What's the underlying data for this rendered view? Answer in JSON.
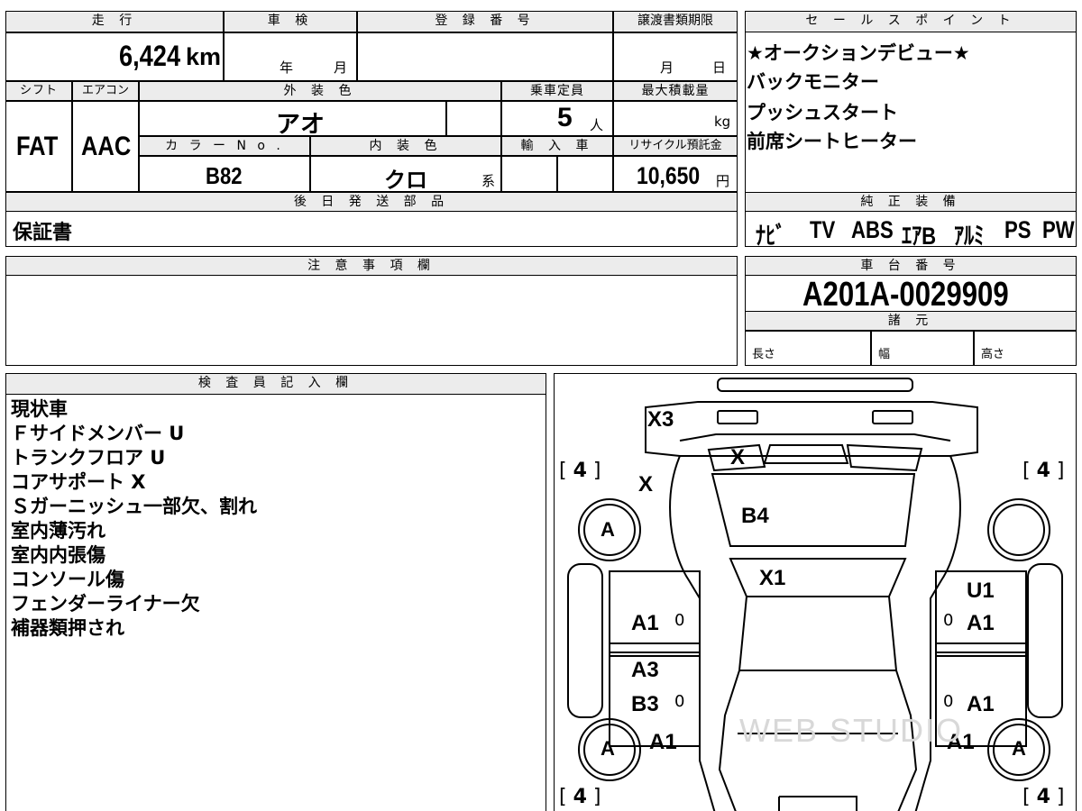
{
  "header": {
    "mileage_label": "走 行",
    "inspection_label": "車 検",
    "registration_label": "登 録 番 号",
    "transfer_deadline_label": "譲渡書類期限",
    "mileage_value": "6,424",
    "mileage_unit": "km",
    "year_unit": "年",
    "month_unit": "月",
    "transfer_month": "月",
    "transfer_day": "日"
  },
  "specs": {
    "shift_label": "シフト",
    "aircon_label": "エアコン",
    "exterior_color_label": "外 装 色",
    "capacity_label": "乗車定員",
    "max_load_label": "最大積載量",
    "shift_value": "FAT",
    "aircon_value": "AAC",
    "exterior_color_value": "アオ",
    "capacity_value": "5",
    "capacity_unit": "人",
    "load_unit": "kg",
    "color_no_label": "カ ラ ー N o .",
    "interior_color_label": "内 装 色",
    "import_label": "輸 入 車",
    "recycle_label": "リサイクル預託金",
    "color_no_value": "B82",
    "interior_color_value": "クロ",
    "interior_suffix": "系",
    "recycle_value": "10,650",
    "recycle_unit": "円"
  },
  "later_parts": {
    "label": "後 日 発 送 部 品",
    "value": "保証書"
  },
  "sales_points": {
    "label": "セ ー ル ス ポ イ ン ト",
    "items": [
      "★オークションデビュー★",
      "バックモニター",
      "プッシュスタート",
      "前席シートヒーター"
    ]
  },
  "genuine_equipment": {
    "label": "純 正 装 備",
    "items": [
      "ﾅﾋﾞ",
      "TV",
      "ABS",
      "ｴｱB",
      "ｱﾙﾐ",
      "PS",
      "PW"
    ]
  },
  "notes": {
    "label": "注 意 事 項 欄",
    "value": ""
  },
  "chassis": {
    "label": "車 台 番 号",
    "value": "A201A-0029909",
    "dims_label": "諸 元",
    "length_label": "長さ",
    "width_label": "幅",
    "height_label": "高さ"
  },
  "inspector": {
    "label": "検 査 員 記 入 欄",
    "lines": [
      "現状車",
      "Ｆサイドメンバー U",
      "トランクフロア U",
      "コアサポート X",
      "Ｓガーニッシュ一部欠、割れ",
      "室内薄汚れ",
      "室内内張傷",
      "コンソール傷",
      "フェンダーライナー欠",
      "補器類押され"
    ]
  },
  "diagram": {
    "tire_tread": "4",
    "wheel_mark": "A",
    "zero_mark": "0",
    "marks": {
      "rear_bumper": "X3",
      "rear_glass": "X",
      "rear_panel_left": "X",
      "roof": "B4",
      "front_glass": "X1",
      "right_rear_fender": "U1",
      "left_rear_door": "A1",
      "right_rear_door": "A1",
      "left_front_door_a": "A3",
      "left_front_door_b": "B3",
      "right_front_door": "A1",
      "left_front_fender": "A1",
      "right_front_fender": "A1"
    },
    "watermark": "WEB STUDIO"
  }
}
